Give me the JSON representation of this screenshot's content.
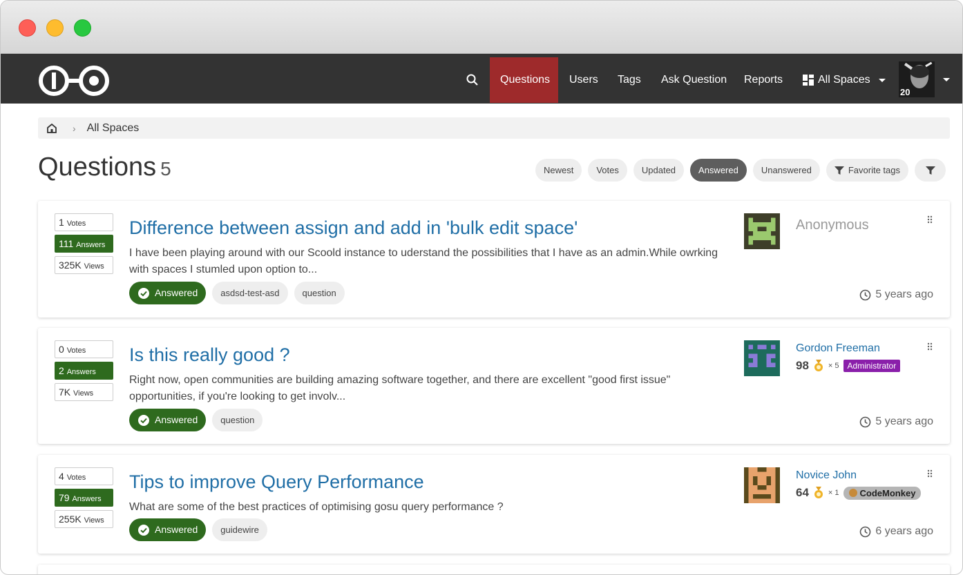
{
  "nav": {
    "items": [
      {
        "label": "Questions"
      },
      {
        "label": "Users"
      },
      {
        "label": "Tags"
      },
      {
        "label": "Ask Question"
      },
      {
        "label": "Reports"
      },
      {
        "label": "All Spaces"
      }
    ],
    "avatar_badge": "20",
    "active_color": "#9e2a2b"
  },
  "breadcrumb": {
    "label": "All Spaces"
  },
  "header": {
    "title": "Questions",
    "count": "5"
  },
  "filters": [
    "Newest",
    "Votes",
    "Updated",
    "Answered",
    "Unanswered",
    "Favorite tags"
  ],
  "questions": [
    {
      "votes": "1",
      "votes_label": "Votes",
      "answers": "111",
      "answers_label": "Answers",
      "views": "325K",
      "views_label": "Views",
      "title": "Difference between assign and add in 'bulk edit space'",
      "excerpt": "I have been playing around with our Scoold instance to uderstand the possibilities that I have as an admin.While owrking with spaces I stumled upon option to...",
      "status": "Answered",
      "tags": [
        "asdsd-test-asd",
        "question"
      ],
      "author": "Anonymous",
      "time": "5 years ago"
    },
    {
      "votes": "0",
      "votes_label": "Votes",
      "answers": "2",
      "answers_label": "Answers",
      "views": "7K",
      "views_label": "Views",
      "title": "Is this really good ?",
      "excerpt": "Right now, open communities are building amazing software together, and there are excellent \"good first issue\" opportunities, if you're looking to get involv...",
      "status": "Answered",
      "tags": [
        "question"
      ],
      "author": "Gordon Freeman",
      "reputation": "98",
      "medals": "× 5",
      "role": "Administrator",
      "time": "5 years ago"
    },
    {
      "votes": "4",
      "votes_label": "Votes",
      "answers": "79",
      "answers_label": "Answers",
      "views": "255K",
      "views_label": "Views",
      "title": "Tips to improve Query Performance",
      "excerpt": "What are some of the best practices of optimising gosu query performance ?",
      "status": "Answered",
      "tags": [
        "guidewire"
      ],
      "author": "Novice John",
      "reputation": "64",
      "medals": "× 1",
      "role": "CodeMonkey",
      "time": "6 years ago"
    }
  ],
  "colors": {
    "navbar": "#333333",
    "answered_green": "#2e6a1e",
    "link_blue": "#1f6ea6",
    "admin_purple": "#8a1faa"
  }
}
